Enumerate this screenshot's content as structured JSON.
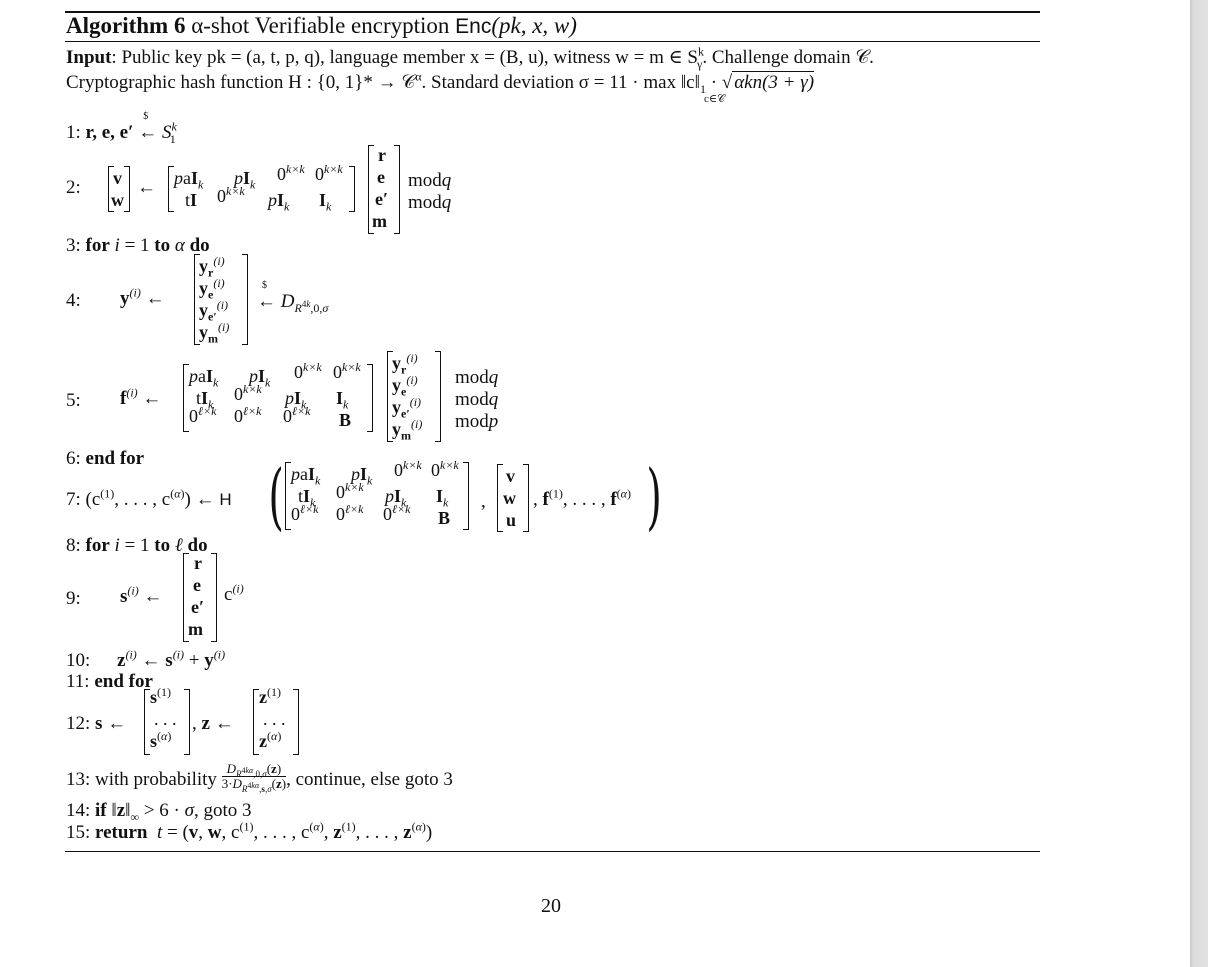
{
  "algorithm": {
    "label": "Algorithm 6",
    "title_prefix": "α-shot Verifiable encryption",
    "title_func": "Enc",
    "title_args": "(pk, x, w)"
  },
  "input": {
    "label": "Input",
    "line1": ": Public key pk = (a, t, p, q), language member x = (B, u), witness w = m ∈ S",
    "line1_sup": "k",
    "line1_sub": "γ",
    "line1_end": ". Challenge domain 𝒞.",
    "line2": "Cryptographic hash function H : {0, 1}* → 𝒞",
    "line2_sup": "α",
    "line2_mid": ". Standard deviation σ = 11 · max ‖c‖",
    "line2_norm_sub": "1",
    "line2_max_sub": "c∈𝒞",
    "line2_sqrt": "αkn(3 + γ)"
  },
  "steps": [
    {
      "n": "1:",
      "text": "r, e, e′ ←$ S₁ᵏ"
    },
    {
      "n": "2:",
      "lhs": [
        "v",
        "w"
      ],
      "matrix": [
        [
          "paI_k",
          "pI_k",
          "0^{k×k}",
          "0^{k×k}"
        ],
        [
          "tI",
          "0^{k×k}",
          "pI_k",
          "I_k"
        ]
      ],
      "vec": [
        "r",
        "e",
        "e′",
        "m"
      ],
      "mods": [
        "mod q",
        "mod q"
      ]
    },
    {
      "n": "3:",
      "kw1": "for",
      "text": "i = 1",
      "kw2": "to",
      "var": "α",
      "kw3": "do"
    },
    {
      "n": "4:",
      "lhs": "y⁽ⁱ⁾ ←",
      "vec": [
        "y_r⁽ⁱ⁾",
        "y_e⁽ⁱ⁾",
        "y_e′⁽ⁱ⁾",
        "y_m⁽ⁱ⁾"
      ],
      "rhs": "←$ D_{R^{4k},0,σ}"
    },
    {
      "n": "5:",
      "lhs": "f⁽ⁱ⁾ ←",
      "matrix": [
        [
          "paI_k",
          "pI_k",
          "0^{k×k}",
          "0^{k×k}"
        ],
        [
          "tI_k",
          "0^{k×k}",
          "pI_k",
          "I_k"
        ],
        [
          "0^{ℓ×k}",
          "0^{ℓ×k}",
          "0^{ℓ×k}",
          "B"
        ]
      ],
      "vec": [
        "y_r⁽ⁱ⁾",
        "y_e⁽ⁱ⁾",
        "y_e′⁽ⁱ⁾",
        "y_m⁽ⁱ⁾"
      ],
      "mods": [
        "mod q",
        "mod q",
        "mod p"
      ]
    },
    {
      "n": "6:",
      "kw": "end for"
    },
    {
      "n": "7:",
      "lhs": "(c⁽¹⁾, . . . , c⁽ᵅ⁾) ← H",
      "matrix": [
        [
          "paI_k",
          "pI_k",
          "0^{k×k}",
          "0^{k×k}"
        ],
        [
          "tI_k",
          "0^{k×k}",
          "pI_k",
          "I_k"
        ],
        [
          "0^{ℓ×k}",
          "0^{ℓ×k}",
          "0^{ℓ×k}",
          "B"
        ]
      ],
      "vec": [
        "v",
        "w",
        "u"
      ],
      "tail": ", f⁽¹⁾, . . . , f⁽ᵅ⁾"
    },
    {
      "n": "8:",
      "kw1": "for",
      "text": "i = 1",
      "kw2": "to",
      "var": "ℓ",
      "kw3": "do"
    },
    {
      "n": "9:",
      "lhs": "s⁽ⁱ⁾ ←",
      "vec": [
        "r",
        "e",
        "e′",
        "m"
      ],
      "rhs": "c⁽ⁱ⁾"
    },
    {
      "n": "10:",
      "text": "z⁽ⁱ⁾ ← s⁽ⁱ⁾ + y⁽ⁱ⁾"
    },
    {
      "n": "11:",
      "kw": "end for"
    },
    {
      "n": "12:",
      "lhs": "s ←",
      "vec1": [
        "s⁽¹⁾",
        "...",
        "s⁽ᵅ⁾"
      ],
      "mid": ", z ←",
      "vec2": [
        "z⁽¹⁾",
        "...",
        "z⁽ᵅ⁾"
      ]
    },
    {
      "n": "13:",
      "text": "with probability",
      "frac_num": "D_{R^{4kα},0,σ}(z)",
      "frac_den": "3·D_{R^{4kα},s,σ}(z)",
      "tail": ", continue, else goto 3"
    },
    {
      "n": "14:",
      "kw": "if",
      "text": "‖z‖∞ > 6 · σ, goto 3"
    },
    {
      "n": "15:",
      "kw": "return",
      "text": "t = (v, w, c⁽¹⁾, . . . , c⁽ᵅ⁾, z⁽¹⁾, . . . , z⁽ᵅ⁾)"
    }
  ],
  "labels": {
    "mod_q": "mod q",
    "mod_p": "mod p",
    "for": "for",
    "to": "to",
    "do": "do",
    "end_for": "end for",
    "if": "if",
    "return": "return",
    "goto3": ", goto 3",
    "with_prob": "with probability",
    "continue_else": ", continue, else goto 3"
  },
  "page_number": "20"
}
